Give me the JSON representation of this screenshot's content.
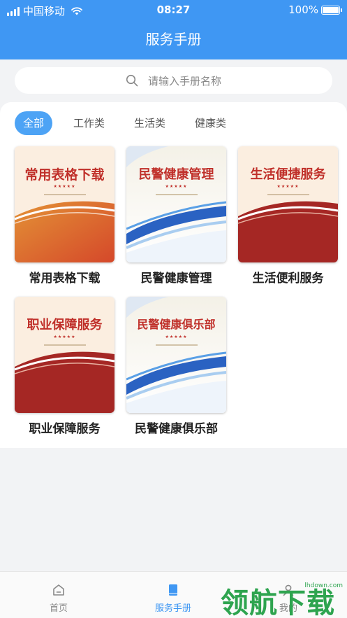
{
  "status": {
    "carrier": "中国移动",
    "time": "08:27",
    "battery": "100%"
  },
  "header": {
    "title": "服务手册"
  },
  "search": {
    "placeholder": "请输入手册名称",
    "icon": "search-icon"
  },
  "tabs": [
    {
      "label": "全部",
      "active": true
    },
    {
      "label": "工作类",
      "active": false
    },
    {
      "label": "生活类",
      "active": false
    },
    {
      "label": "健康类",
      "active": false
    }
  ],
  "manuals": [
    {
      "cover_title": "常用表格下载",
      "caption": "常用表格下载",
      "theme": "orange-red"
    },
    {
      "cover_title": "民警健康管理",
      "caption": "民警健康管理",
      "theme": "blue-wave"
    },
    {
      "cover_title": "生活便捷服务",
      "caption": "生活便利服务",
      "theme": "red"
    },
    {
      "cover_title": "职业保障服务",
      "caption": "职业保障服务",
      "theme": "red"
    },
    {
      "cover_title": "民警健康俱乐部",
      "caption": "民警健康俱乐部",
      "theme": "blue-wave"
    }
  ],
  "tabbar": [
    {
      "label": "首页",
      "icon": "home-icon",
      "active": false
    },
    {
      "label": "服务手册",
      "icon": "book-icon",
      "active": true
    },
    {
      "label": "我的",
      "icon": "user-icon",
      "active": false
    }
  ],
  "watermark": {
    "text": "领航下载",
    "url": "lhdown.com"
  },
  "colors": {
    "primary": "#3f97f3",
    "cover_red": "#c0302a",
    "watermark_green": "#2ea44f"
  }
}
